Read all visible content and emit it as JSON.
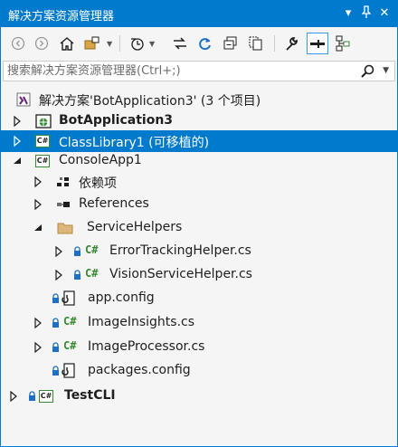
{
  "window": {
    "title": "解决方案资源管理器",
    "title_buttons": [
      "▾",
      "ᵖ",
      "✕"
    ]
  },
  "search": {
    "placeholder": "搜索解决方案资源管理器(Ctrl+;)"
  },
  "tree": {
    "solution": "解决方案'BotApplication3' (3 个项目)",
    "items": [
      {
        "label": "BotApplication3",
        "bold": true
      },
      {
        "label": "ClassLibrary1 (可移植的)",
        "selected": true
      },
      {
        "label": "ConsoleApp1"
      },
      {
        "label": "依赖项"
      },
      {
        "label": "References"
      },
      {
        "label": "ServiceHelpers"
      },
      {
        "label": "ErrorTrackingHelper.cs"
      },
      {
        "label": "VisionServiceHelper.cs"
      },
      {
        "label": "app.config"
      },
      {
        "label": "ImageInsights.cs"
      },
      {
        "label": "ImageProcessor.cs"
      },
      {
        "label": "packages.config"
      },
      {
        "label": "TestCLI",
        "bold": true
      }
    ],
    "icons": {
      "csharp_badge": "C#",
      "csharp_file": "C#"
    }
  },
  "colors": {
    "accent": "#007acc",
    "background": "#f5f5f5",
    "csharp_green": "#388a34",
    "lock_blue": "#1e70c2"
  }
}
